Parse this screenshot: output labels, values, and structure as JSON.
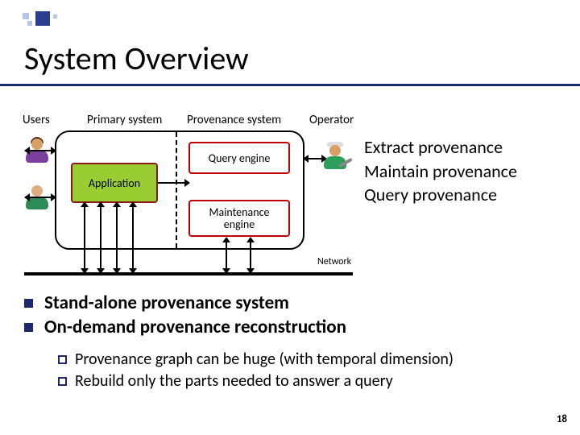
{
  "title": "System Overview",
  "labels": {
    "users": "Users",
    "primary": "Primary system",
    "provenance": "Provenance system",
    "operator": "Operator"
  },
  "boxes": {
    "application": "Application",
    "query_engine": "Query engine",
    "maintenance_engine": "Maintenance\nengine"
  },
  "network": "Network",
  "side_text": {
    "l1": "Extract provenance",
    "l2": "Maintain provenance",
    "l3": "Query provenance"
  },
  "bullets": {
    "b1": "Stand-alone provenance system",
    "b2": "On-demand provenance reconstruction",
    "s1": "Provenance graph can be huge (with temporal dimension)",
    "s2": "Rebuild only the parts needed to answer a query"
  },
  "page": "18"
}
